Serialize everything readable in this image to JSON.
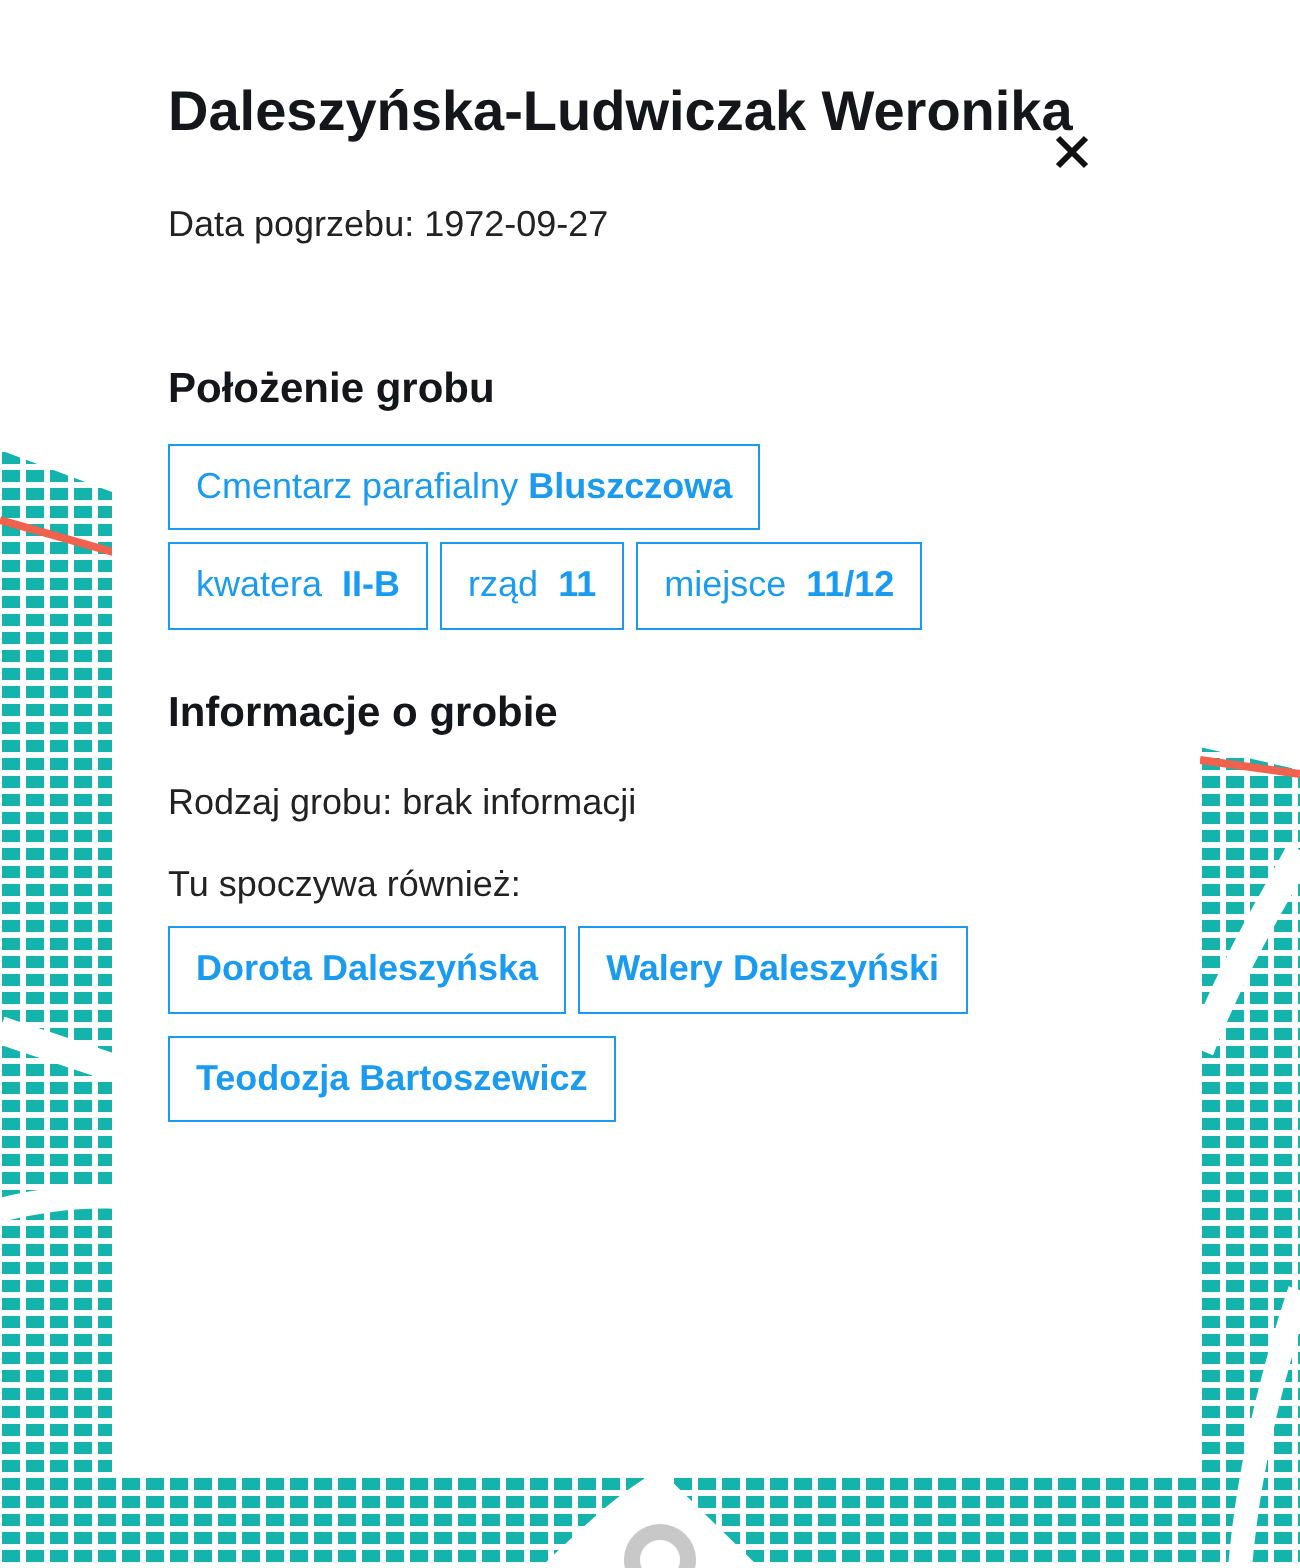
{
  "title": "Daleszyńska-Ludwiczak Weronika",
  "burial_date": "Data pogrzebu: 1972-09-27",
  "location": {
    "heading": "Położenie grobu",
    "cemetery": "Cmentarz parafialny **Bluszczowa**",
    "parts": [
      "kwatera  **II-B**",
      "rząd  **11**",
      "miejsce  **11/12**"
    ]
  },
  "info": {
    "heading": "Informacje o grobie",
    "grave_type": "Rodzaj grobu: brak informacji",
    "also_here": "Tu spoczywa również:",
    "people": [
      "Dorota Daleszyńska",
      "Walery Daleszyński",
      "Teodozja Bartoszewicz"
    ]
  }
}
